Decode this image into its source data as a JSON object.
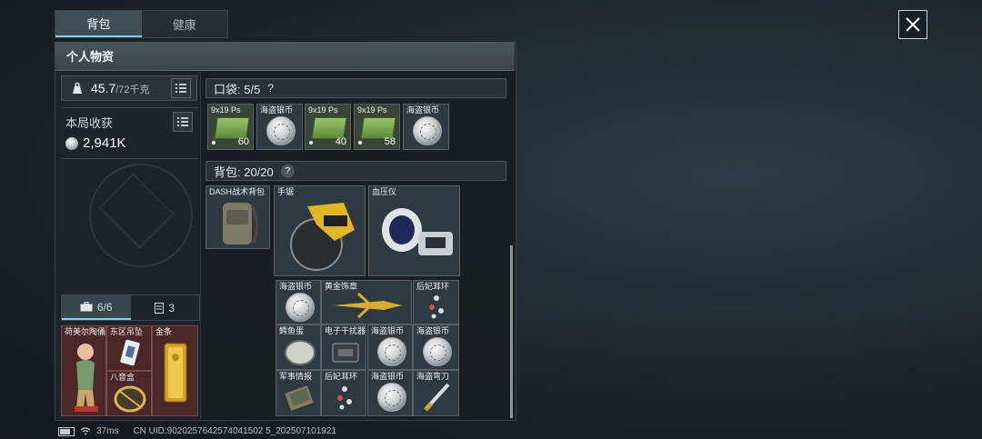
{
  "tabs": [
    {
      "label": "背包"
    },
    {
      "label": "健康"
    }
  ],
  "panel": {
    "title": "个人物资"
  },
  "weight": {
    "current": "45.7",
    "max": "/72千克"
  },
  "haul": {
    "label": "本局收获",
    "value": "2,941K"
  },
  "sub_tabs": [
    {
      "label": "6/6"
    },
    {
      "label": "3"
    }
  ],
  "pocket": {
    "label": "口袋: 5/5",
    "help": "?"
  },
  "backpack": {
    "label": "背包: 20/20",
    "help": "?"
  },
  "pocket_items": [
    {
      "name": "9x19 Ps",
      "count": "60"
    },
    {
      "name": "海盗银币"
    },
    {
      "name": "9x19 Ps",
      "count": "40"
    },
    {
      "name": "9x19 Ps",
      "count": "58"
    },
    {
      "name": "海盗银币"
    }
  ],
  "backpack_items": [
    {
      "name": "DASH战术背包"
    },
    {
      "name": "手锯"
    },
    {
      "name": "血压仪"
    },
    {
      "name": "海盗银币"
    },
    {
      "name": "黄金饰章"
    },
    {
      "name": "后妃耳环"
    },
    {
      "name": "鳄鱼蛋"
    },
    {
      "name": "电子干扰器"
    },
    {
      "name": "海盗银币"
    },
    {
      "name": "海盗银币"
    },
    {
      "name": "军事情报"
    },
    {
      "name": "后妃耳环"
    },
    {
      "name": "海盗银币"
    },
    {
      "name": "海盗弯刀"
    }
  ],
  "safe_items": [
    {
      "name": "荷美尔陶俑"
    },
    {
      "name": "东区吊坠"
    },
    {
      "name": "金条"
    },
    {
      "name": "八音盒"
    }
  ],
  "status": {
    "ping": "37ms",
    "uid": "CN UID:9020257642574041502 5_202507101921"
  }
}
